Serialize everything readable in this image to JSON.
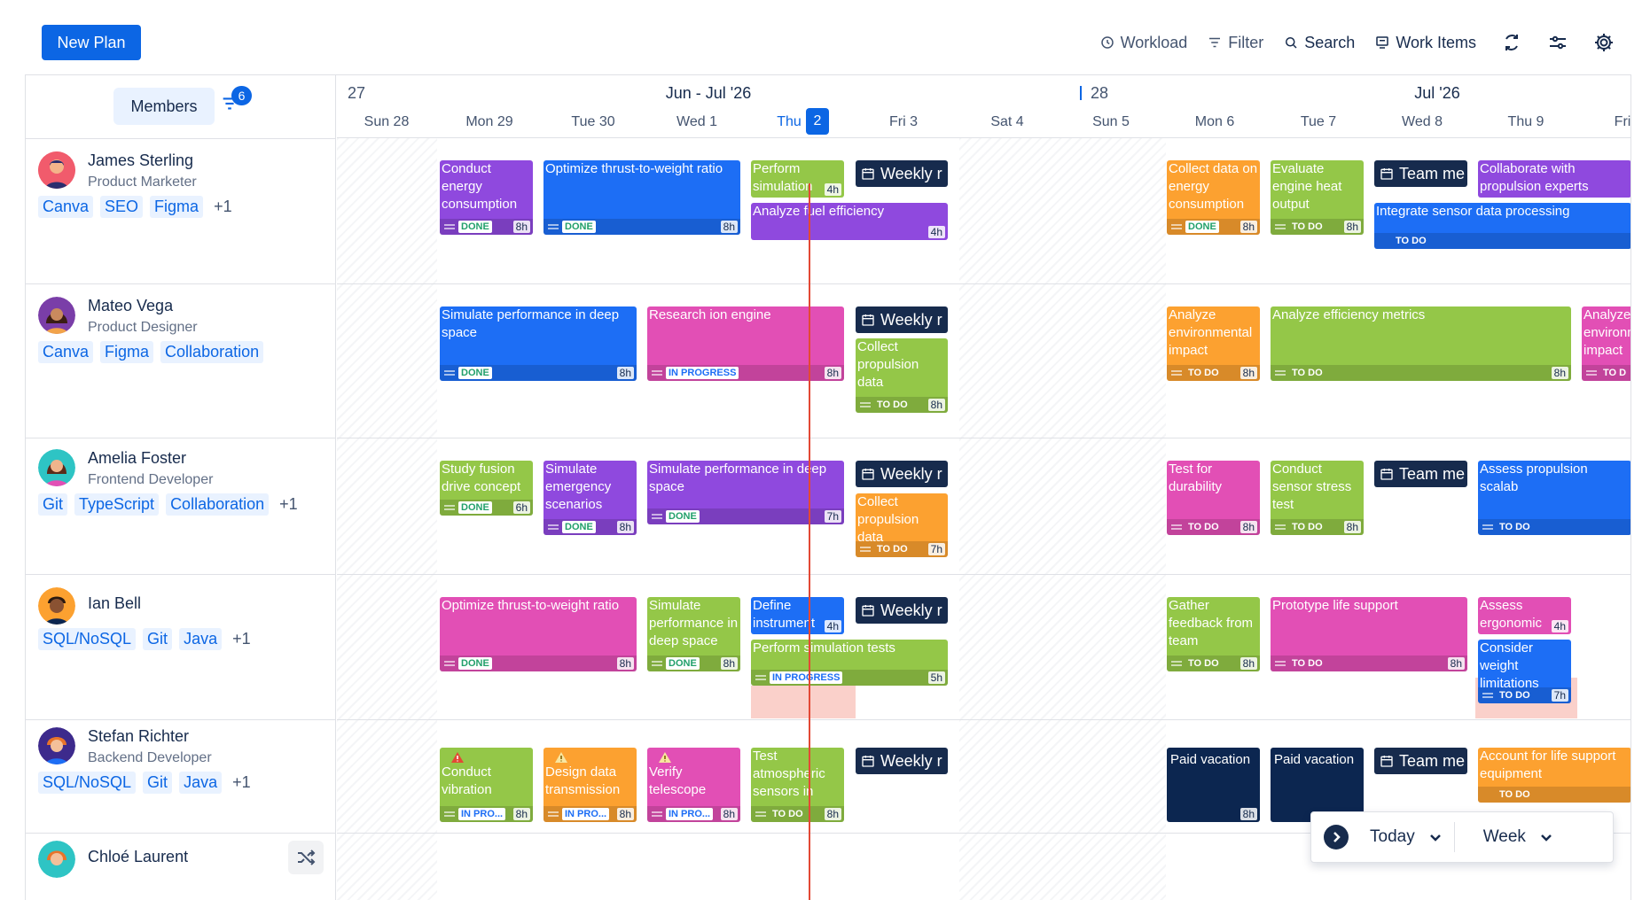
{
  "toolbar": {
    "new_plan": "New Plan",
    "workload": "Workload",
    "filter": "Filter",
    "search": "Search",
    "work_items": "Work Items"
  },
  "sidebar": {
    "members_label": "Members",
    "filter_count": "6",
    "people": [
      {
        "name": "James Sterling",
        "role": "Product Marketer",
        "tags": [
          "Canva",
          "SEO",
          "Figma"
        ],
        "more": "+1"
      },
      {
        "name": "Mateo Vega",
        "role": "Product Designer",
        "tags": [
          "Canva",
          "Figma",
          "Collaboration"
        ],
        "more": ""
      },
      {
        "name": "Amelia Foster",
        "role": "Frontend Developer",
        "tags": [
          "Git",
          "TypeScript",
          "Collaboration"
        ],
        "more": "+1"
      },
      {
        "name": "Ian Bell",
        "role": "",
        "tags": [
          "SQL/NoSQL",
          "Git",
          "Java"
        ],
        "more": "+1"
      },
      {
        "name": "Stefan Richter",
        "role": "Backend Developer",
        "tags": [
          "SQL/NoSQL",
          "Git",
          "Java"
        ],
        "more": "+1"
      },
      {
        "name": "Chloé Laurent",
        "role": "",
        "tags": [],
        "more": ""
      }
    ]
  },
  "calendar": {
    "week_labels": [
      "27",
      "28"
    ],
    "month_labels": [
      "Jun - Jul '26",
      "Jul '26"
    ],
    "days": [
      "Sun 28",
      "Mon 29",
      "Tue 30",
      "Wed 1",
      "Thu",
      "Fri 3",
      "Sat 4",
      "Sun 5",
      "Mon 6",
      "Tue 7",
      "Wed 8",
      "Thu 9",
      "Fri"
    ],
    "today_number": "2"
  },
  "tasks": {
    "r0": [
      {
        "title": "Conduct energy consumption",
        "status": "DONE",
        "hours": "8h"
      },
      {
        "title": "Optimize thrust-to-weight ratio",
        "status": "DONE",
        "hours": "8h"
      },
      {
        "title": "Perform simulation",
        "status": "",
        "hours": "4h"
      },
      {
        "title": "Analyze fuel efficiency",
        "status": "",
        "hours": "4h"
      },
      {
        "title": "Weekly r",
        "status": "",
        "hours": ""
      },
      {
        "title": "Collect data on energy consumption",
        "status": "DONE",
        "hours": "8h"
      },
      {
        "title": "Evaluate engine heat output",
        "status": "TO DO",
        "hours": "8h"
      },
      {
        "title": "Team me",
        "status": "",
        "hours": ""
      },
      {
        "title": "Collaborate with propulsion experts",
        "status": "",
        "hours": ""
      },
      {
        "title": "Integrate sensor data processing",
        "status": "TO DO",
        "hours": ""
      }
    ],
    "r1": [
      {
        "title": "Simulate performance in deep space",
        "status": "DONE",
        "hours": "8h"
      },
      {
        "title": "Research ion engine",
        "status": "IN PROGRESS",
        "hours": "8h"
      },
      {
        "title": "Weekly r",
        "status": "",
        "hours": ""
      },
      {
        "title": "Collect propulsion data",
        "status": "TO DO",
        "hours": "8h"
      },
      {
        "title": "Analyze environmental impact",
        "status": "TO DO",
        "hours": "8h"
      },
      {
        "title": "Analyze efficiency metrics",
        "status": "TO DO",
        "hours": "8h"
      },
      {
        "title": "Analyze environmental impact",
        "status": "TO D",
        "hours": ""
      }
    ],
    "r2": [
      {
        "title": "Study fusion drive concept",
        "status": "DONE",
        "hours": "6h"
      },
      {
        "title": "Simulate emergency scenarios",
        "status": "DONE",
        "hours": "8h"
      },
      {
        "title": "Simulate performance in deep space",
        "status": "DONE",
        "hours": "7h"
      },
      {
        "title": "Weekly r",
        "status": "",
        "hours": ""
      },
      {
        "title": "Collect propulsion data",
        "status": "TO DO",
        "hours": "7h"
      },
      {
        "title": "Test for durability",
        "status": "TO DO",
        "hours": "8h"
      },
      {
        "title": "Conduct sensor stress test",
        "status": "TO DO",
        "hours": "8h"
      },
      {
        "title": "Team me",
        "status": "",
        "hours": ""
      },
      {
        "title": "Assess propulsion scalab",
        "status": "TO DO",
        "hours": ""
      }
    ],
    "r3": [
      {
        "title": "Optimize thrust-to-weight ratio",
        "status": "DONE",
        "hours": "8h"
      },
      {
        "title": "Simulate performance in deep space",
        "status": "DONE",
        "hours": "8h"
      },
      {
        "title": "Define instrument",
        "status": "",
        "hours": "4h"
      },
      {
        "title": "Weekly r",
        "status": "",
        "hours": ""
      },
      {
        "title": "Perform simulation tests",
        "status": "IN PROGRESS",
        "hours": "5h"
      },
      {
        "title": "Gather feedback from team",
        "status": "TO DO",
        "hours": "8h"
      },
      {
        "title": "Prototype life support",
        "status": "TO DO",
        "hours": "8h"
      },
      {
        "title": "Assess ergonomic",
        "status": "",
        "hours": "4h"
      },
      {
        "title": "Consider weight limitations",
        "status": "TO DO",
        "hours": "7h"
      }
    ],
    "r4": [
      {
        "title": "Conduct vibration",
        "status": "IN PRO...",
        "hours": "8h"
      },
      {
        "title": "Design data transmission",
        "status": "IN PRO...",
        "hours": "8h"
      },
      {
        "title": "Verify telescope",
        "status": "IN PRO...",
        "hours": "8h"
      },
      {
        "title": "Test atmospheric sensors in",
        "status": "TO DO",
        "hours": "8h"
      },
      {
        "title": "Weekly r",
        "status": "",
        "hours": ""
      },
      {
        "title": "Paid vacation",
        "status": "",
        "hours": "8h"
      },
      {
        "title": "Paid vacation",
        "status": "",
        "hours": ""
      },
      {
        "title": "Team me",
        "status": "",
        "hours": ""
      },
      {
        "title": "Account for life support equipment",
        "status": "TO DO",
        "hours": ""
      }
    ]
  },
  "bottom_bar": {
    "today": "Today",
    "view": "Week"
  }
}
